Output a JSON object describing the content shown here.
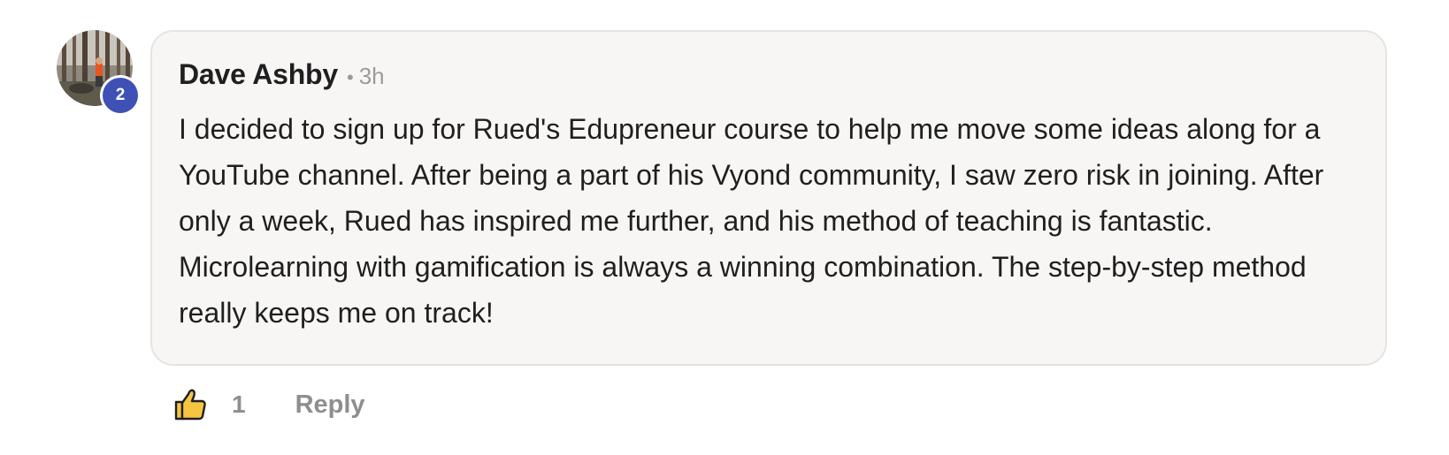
{
  "comment": {
    "author": "Dave Ashby",
    "separator": "•",
    "time_ago": "3h",
    "level": "2",
    "body": "I decided to sign up for Rued's Edupreneur course to help me move some ideas along for a YouTube channel. After being a part of his Vyond community, I saw zero risk in joining. After only a week, Rued has inspired me further, and his method of teaching is fantastic. Microlearning with gamification is always a winning combination. The step-by-step method really keeps me on track!"
  },
  "actions": {
    "like_icon": "thumbs-up-icon",
    "like_count": "1",
    "reply_label": "Reply"
  },
  "colors": {
    "badge": "#3f51b5",
    "bubble_bg": "#f7f6f5",
    "bubble_border": "#e6e4e1",
    "like_fill": "#f5c542",
    "muted_text": "#8e8e8e"
  }
}
